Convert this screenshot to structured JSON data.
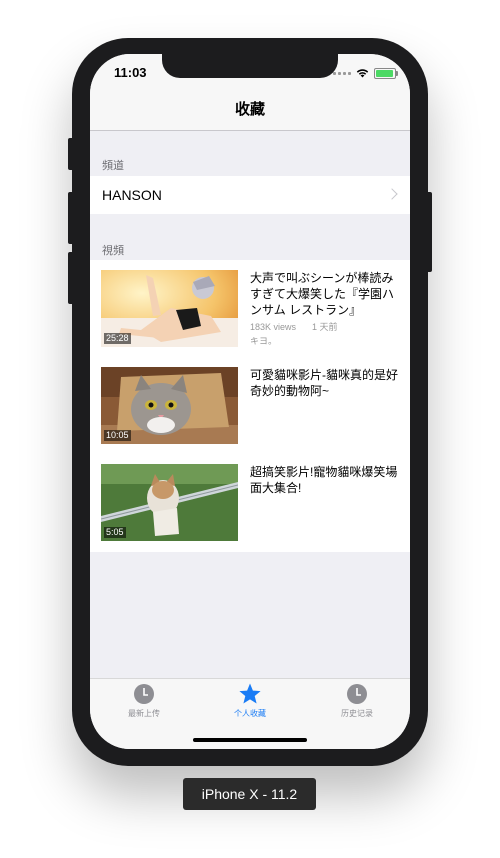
{
  "status_bar": {
    "time": "11:03"
  },
  "nav": {
    "title": "收藏"
  },
  "sections": {
    "channels_header": "頻道",
    "videos_header": "視頻"
  },
  "channels": [
    {
      "name": "HANSON"
    }
  ],
  "videos": [
    {
      "title": "大声で叫ぶシーンが棒読みすぎて大爆笑した『学園ハンサム レストラン』",
      "duration": "25:28",
      "views": "183K views",
      "time_ago": "1 天前",
      "extra": "キヨ。"
    },
    {
      "title": "可愛貓咪影片-貓咪真的是好奇妙的動物阿~",
      "duration": "10:05"
    },
    {
      "title": "超搞笑影片!寵物貓咪爆笑場面大集合!",
      "duration": "5:05"
    }
  ],
  "tab_bar": {
    "tabs": [
      {
        "label": "最新上传",
        "icon": "clock-icon",
        "active": false
      },
      {
        "label": "个人收藏",
        "icon": "star-icon",
        "active": true
      },
      {
        "label": "历史记录",
        "icon": "clock-icon",
        "active": false
      }
    ]
  },
  "device_label": "iPhone X - 11.2",
  "colors": {
    "accent": "#1a7cf5",
    "tab_inactive": "#8e8e93",
    "background": "#efeff4"
  }
}
